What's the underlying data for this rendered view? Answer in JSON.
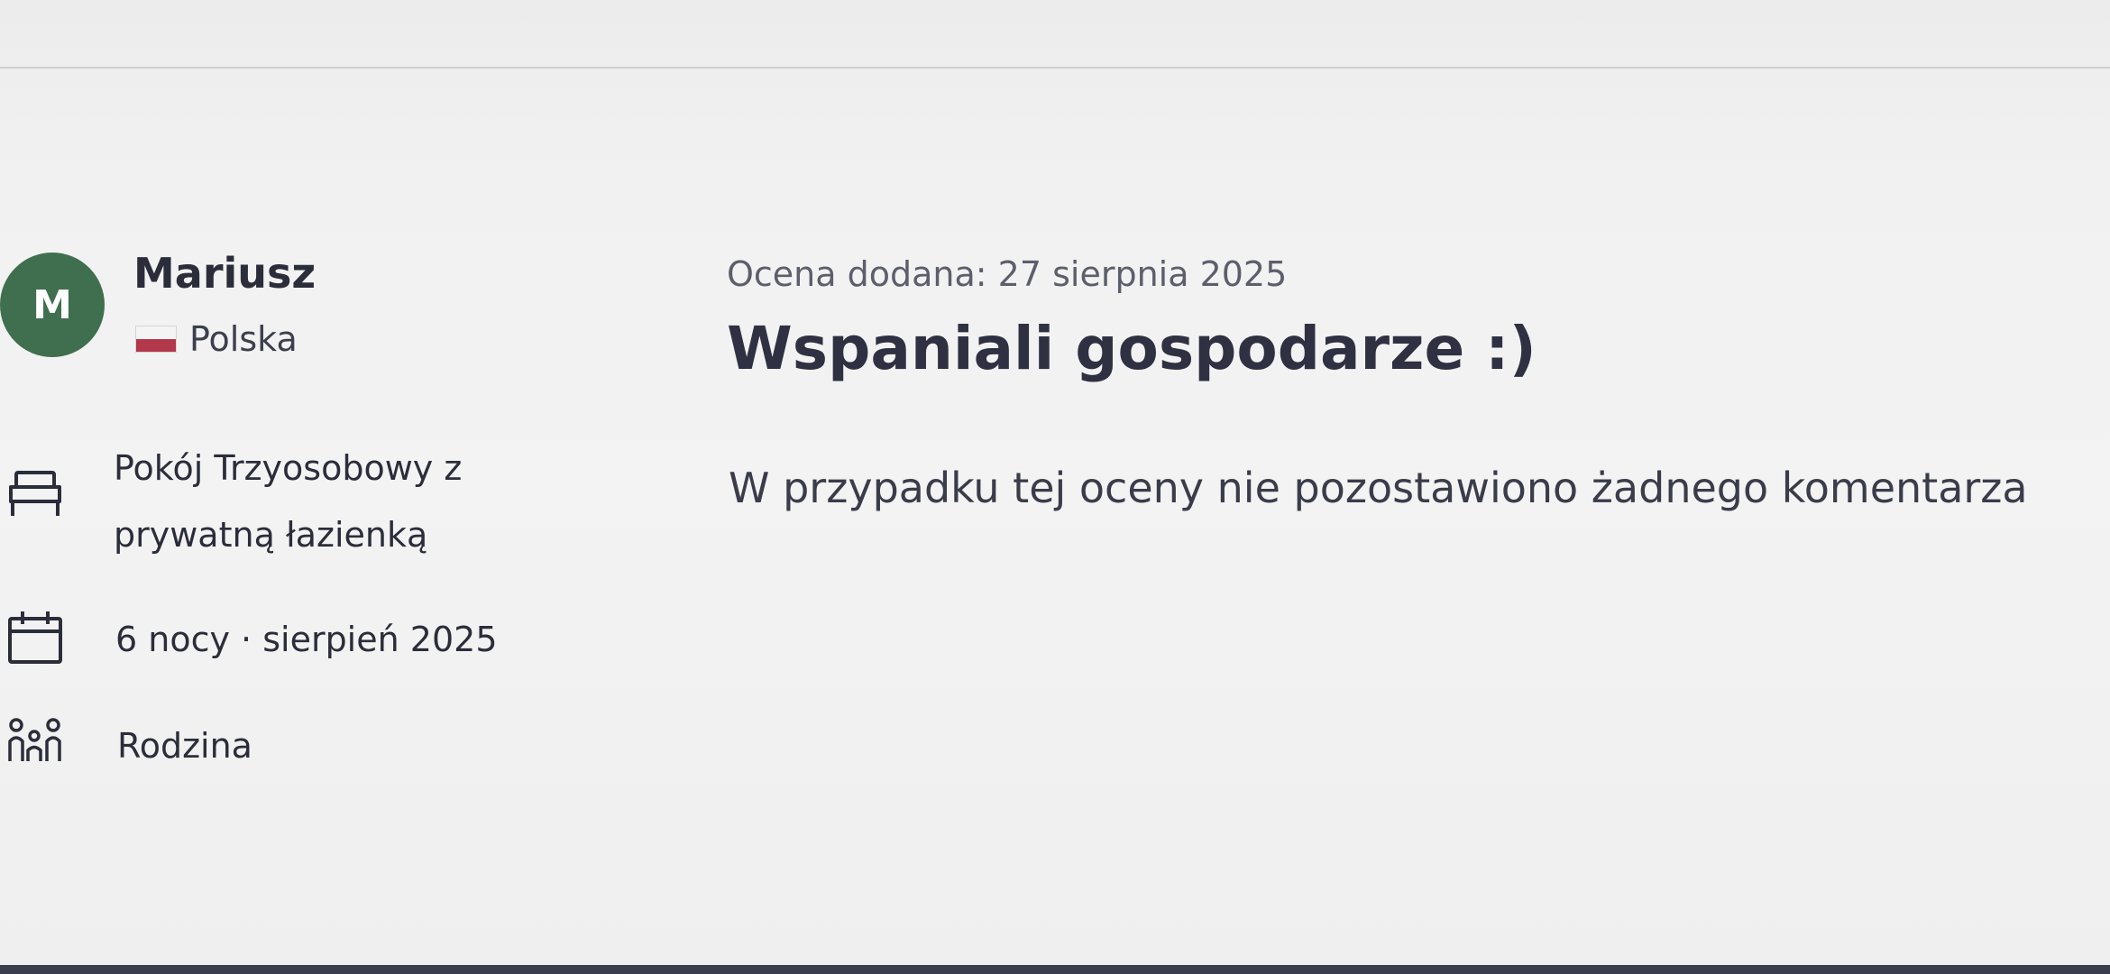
{
  "reviewer": {
    "initial": "M",
    "name": "Mariusz",
    "country": "Polska",
    "avatar_color": "#3f6f4e"
  },
  "stay": {
    "room": "Pokój Trzyosobowy z prywatną łazienką",
    "room_icon": "bed-icon",
    "duration": "6 nocy · sierpień 2025",
    "duration_icon": "calendar-icon",
    "traveler_type": "Rodzina",
    "traveler_icon": "group-icon"
  },
  "review": {
    "date_added": "Ocena dodana: 27 sierpnia 2025",
    "title": "Wspaniali gospodarze :)",
    "body": "W przypadku tej oceny nie pozostawiono żadnego komentarza"
  }
}
